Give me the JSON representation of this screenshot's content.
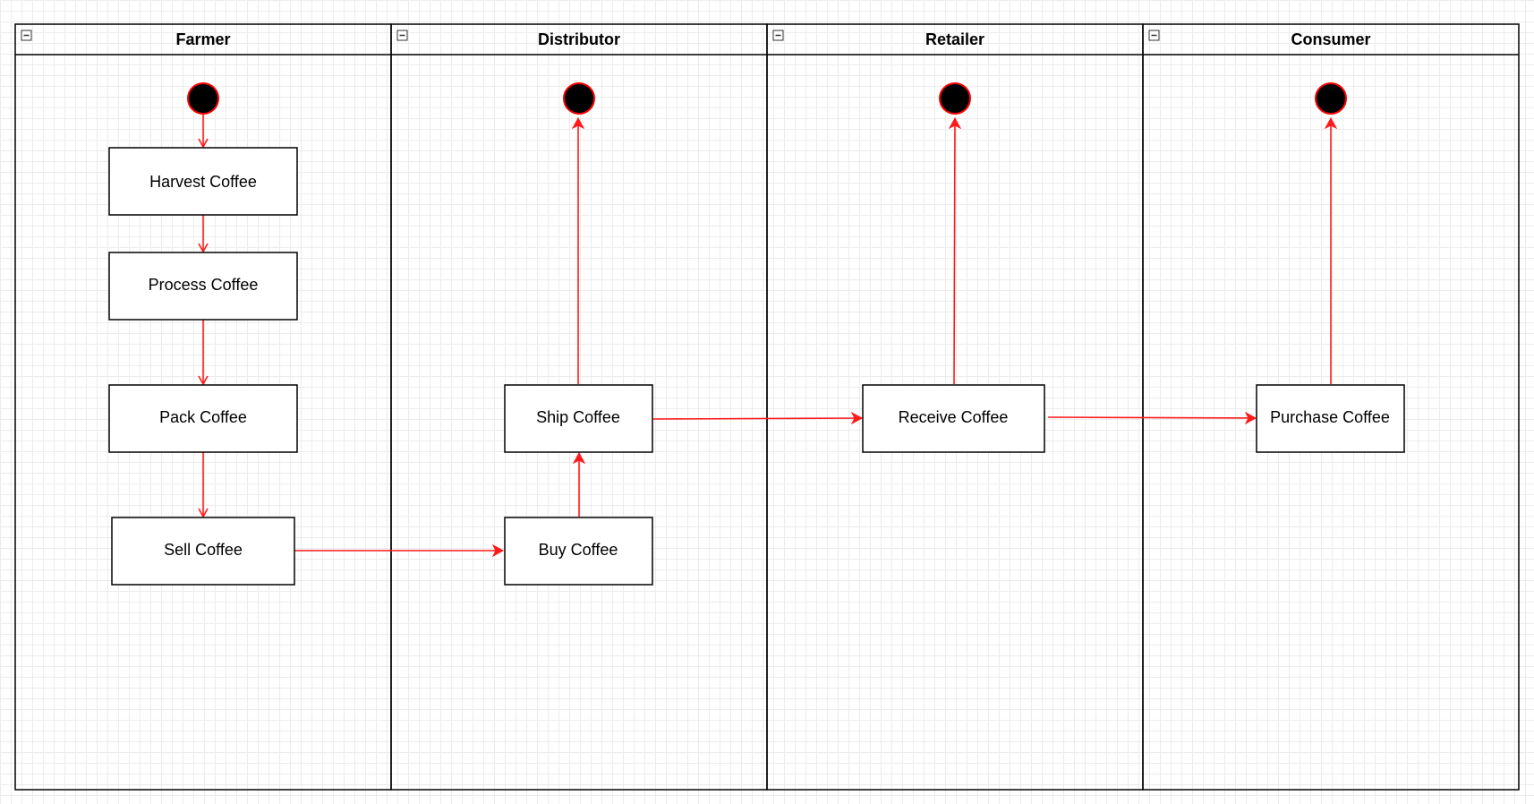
{
  "colors": {
    "flow": "#ff1a1a",
    "border": "#000000",
    "grid": "#ececec",
    "node_fill": "#ffffff",
    "start_fill": "#000000",
    "start_outline": "#ff0000"
  },
  "icons": {
    "collapse": "minus-square-icon"
  },
  "lanes": [
    {
      "id": "farmer",
      "title": "Farmer"
    },
    {
      "id": "distributor",
      "title": "Distributor"
    },
    {
      "id": "retailer",
      "title": "Retailer"
    },
    {
      "id": "consumer",
      "title": "Consumer"
    }
  ],
  "nodes": {
    "harvest": {
      "label": "Harvest Coffee",
      "lane": "farmer"
    },
    "process": {
      "label": "Process Coffee",
      "lane": "farmer"
    },
    "pack": {
      "label": "Pack Coffee",
      "lane": "farmer"
    },
    "sell": {
      "label": "Sell Coffee",
      "lane": "farmer"
    },
    "buy": {
      "label": "Buy Coffee",
      "lane": "distributor"
    },
    "ship": {
      "label": "Ship Coffee",
      "lane": "distributor"
    },
    "receive": {
      "label": "Receive Coffee",
      "lane": "retailer"
    },
    "purchase": {
      "label": "Purchase Coffee",
      "lane": "consumer"
    }
  },
  "terminals": [
    {
      "id": "start-farmer",
      "lane": "farmer"
    },
    {
      "id": "end-distributor",
      "lane": "distributor"
    },
    {
      "id": "end-retailer",
      "lane": "retailer"
    },
    {
      "id": "end-consumer",
      "lane": "consumer"
    }
  ],
  "edges": [
    {
      "from": "start-farmer",
      "to": "harvest"
    },
    {
      "from": "harvest",
      "to": "process"
    },
    {
      "from": "process",
      "to": "pack"
    },
    {
      "from": "pack",
      "to": "sell"
    },
    {
      "from": "sell",
      "to": "buy"
    },
    {
      "from": "buy",
      "to": "ship"
    },
    {
      "from": "ship",
      "to": "end-distributor"
    },
    {
      "from": "ship",
      "to": "receive"
    },
    {
      "from": "receive",
      "to": "end-retailer"
    },
    {
      "from": "receive",
      "to": "purchase"
    },
    {
      "from": "purchase",
      "to": "end-consumer"
    }
  ]
}
